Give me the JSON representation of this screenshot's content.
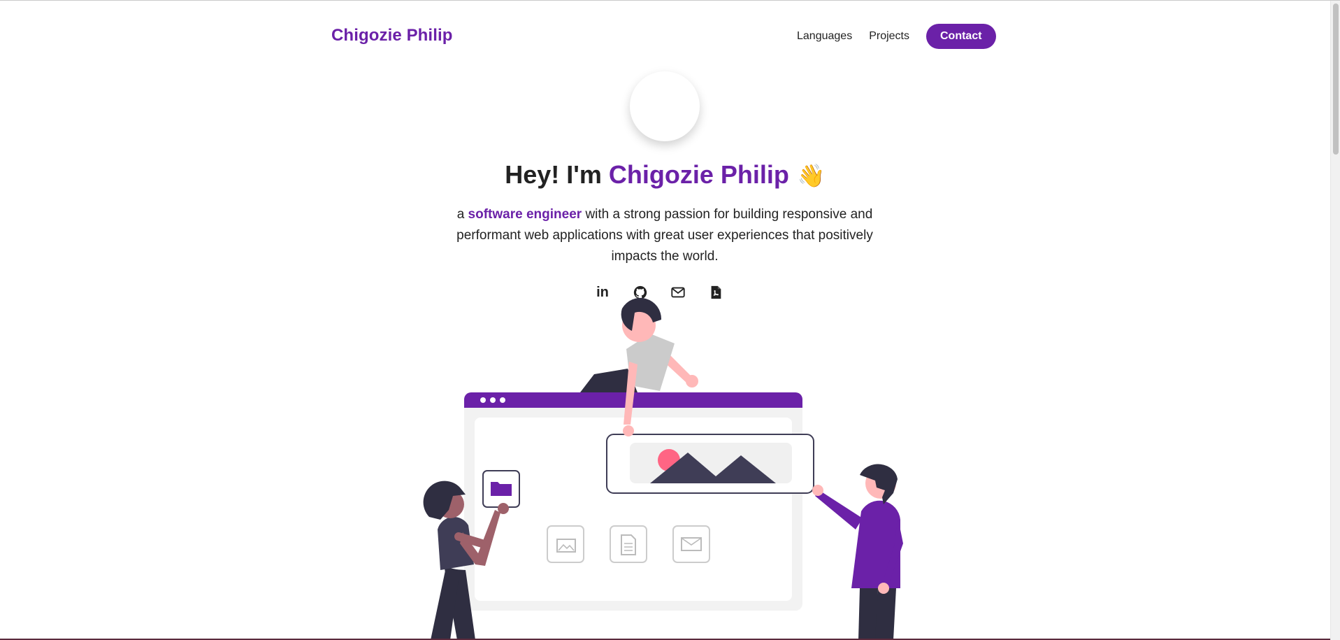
{
  "header": {
    "brand": "Chigozie Philip",
    "nav": {
      "languages": "Languages",
      "projects": "Projects",
      "contact": "Contact"
    }
  },
  "hero": {
    "greeting": "Hey! I'm",
    "name": "Chigozie Philip",
    "wave_emoji": "👋",
    "tagline_prefix": "a",
    "tagline_highlight": "software engineer",
    "tagline_rest": "with a strong passion for building responsive and performant web applications with great user experiences that positively impacts the world."
  },
  "socials": [
    {
      "icon": "linkedin-icon",
      "label": "in"
    },
    {
      "icon": "github-icon"
    },
    {
      "icon": "mail-icon"
    },
    {
      "icon": "pdf-icon"
    }
  ],
  "colors": {
    "accent": "#6b21a8",
    "text": "#222222"
  }
}
